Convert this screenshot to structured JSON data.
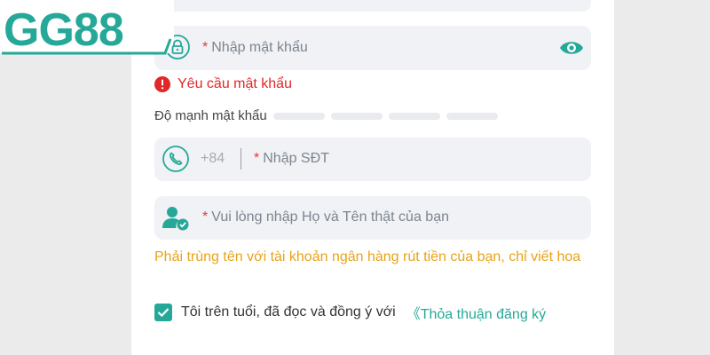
{
  "brand": {
    "logo_text": "GG88",
    "accent": "#26a899"
  },
  "password": {
    "required_mark": "*",
    "placeholder": "Nhập mật khẩu",
    "error": "Yêu cầu mật khẩu",
    "strength_label": "Độ mạnh mật khẩu"
  },
  "phone": {
    "country_code": "+84",
    "required_mark": "*",
    "placeholder": "Nhập SĐT"
  },
  "name": {
    "required_mark": "*",
    "placeholder": "Vui lòng nhập Họ và Tên thật của bạn",
    "hint": "Phải trùng tên với tài khoản ngân hàng rút tiền của bạn, chỉ viết hoa"
  },
  "agreement": {
    "checked": true,
    "text": "Tôi trên tuổi, đã đọc và đồng ý với",
    "link": "《Thỏa thuận đăng ký"
  }
}
